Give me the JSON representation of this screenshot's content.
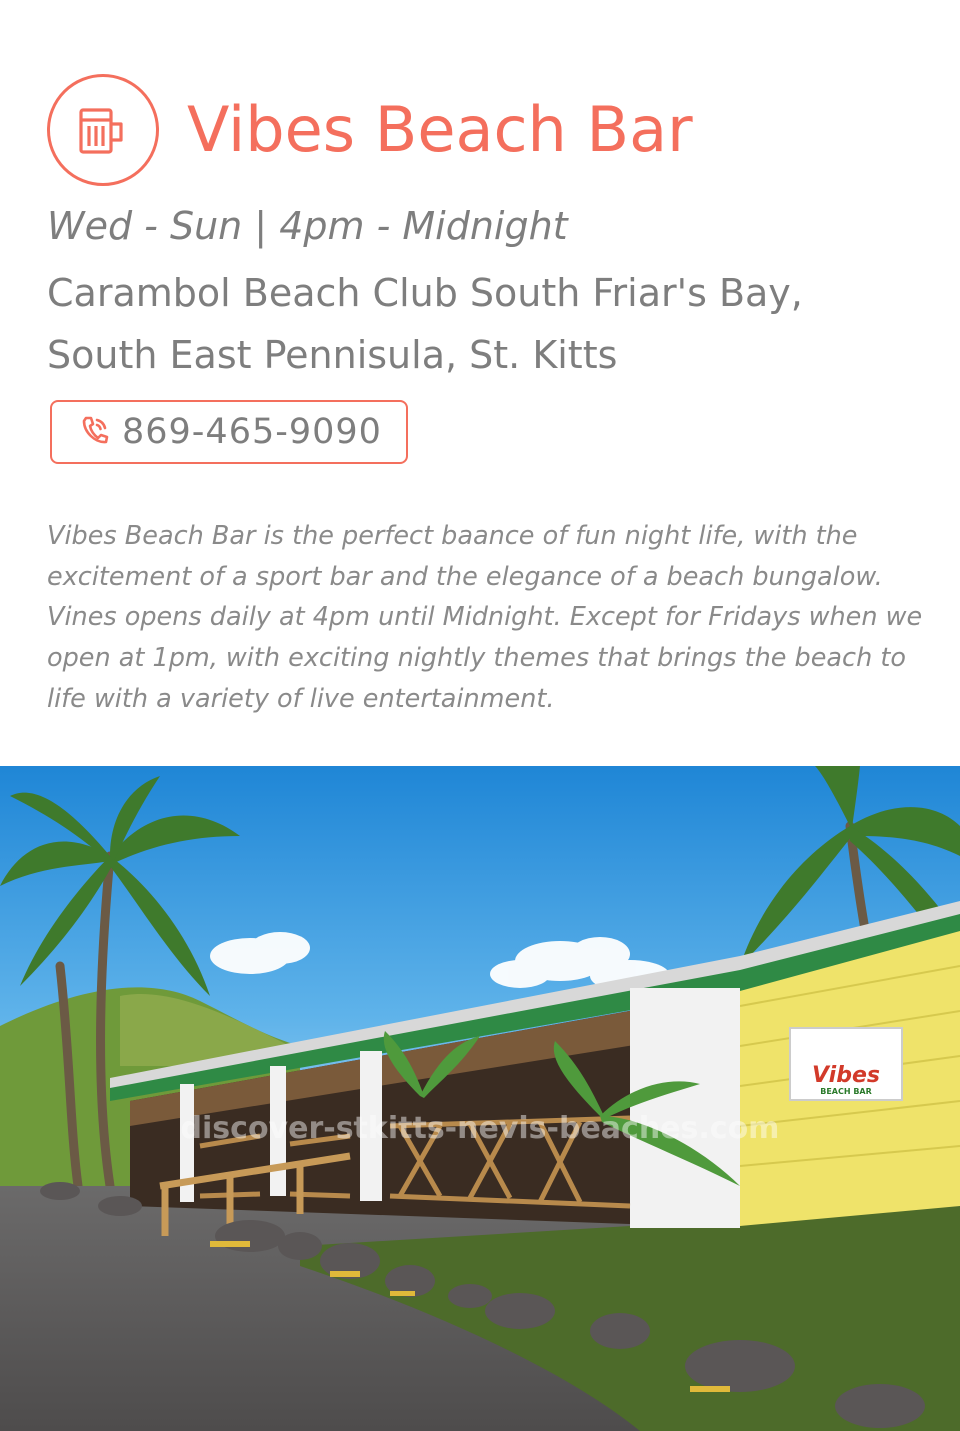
{
  "bar": {
    "name": "Vibes Beach Bar",
    "icon": "beer-mug-icon",
    "hours": "Wed - Sun | 4pm - Midnight",
    "address_line1": "Carambol Beach Club South Friar's Bay,",
    "address_line2": "South East Pennisula, St. Kitts",
    "phone": "869-465-9090",
    "phone_icon": "phone-icon",
    "description": "Vibes Beach Bar is the perfect baance of fun night life, with the excitement of a sport bar and the elegance of a beach bungalow. Vines opens daily at 4pm until Midnight. Except for Fridays when we open at 1pm, with exciting nightly themes that brings the beach to life with a variety of live entertainment."
  },
  "photo": {
    "sign_text": "Vibes",
    "sign_subtext": "BEACH BAR",
    "watermark": "discover-stkitts-nevis-beaches.com"
  },
  "colors": {
    "accent": "#f46f5d",
    "text": "#7e7e7e"
  }
}
